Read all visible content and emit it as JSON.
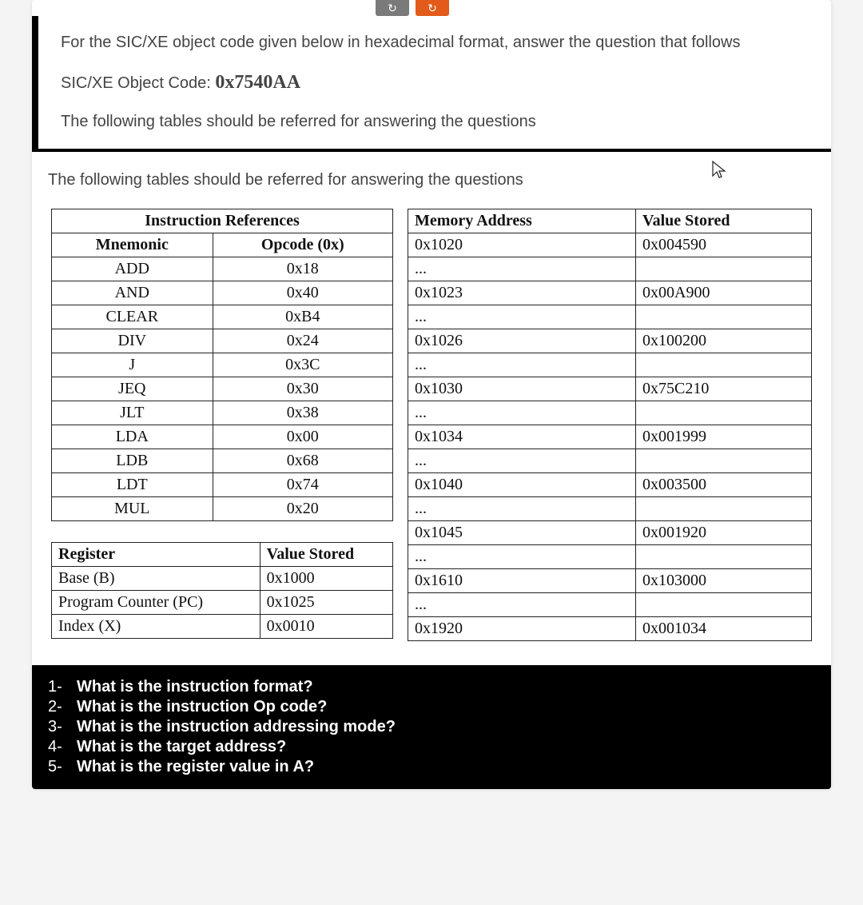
{
  "tabs": {
    "a_icon": "↻",
    "b_icon": "↻"
  },
  "intro": "For the SIC/XE object code given below in hexadecimal format, answer the question that follows",
  "object_code_label": "SIC/XE Object Code: ",
  "object_code_value": "0x7540AA",
  "ref_note": "The following tables should be referred for answering the questions",
  "ref_note_2": "The following tables should be referred for answering the questions",
  "instr_table": {
    "title": "Instruction References",
    "col1": "Mnemonic",
    "col2": "Opcode (0x)",
    "rows": [
      {
        "mn": "ADD",
        "op": "0x18"
      },
      {
        "mn": "AND",
        "op": "0x40"
      },
      {
        "mn": "CLEAR",
        "op": "0xB4"
      },
      {
        "mn": "DIV",
        "op": "0x24"
      },
      {
        "mn": "J",
        "op": "0x3C"
      },
      {
        "mn": "JEQ",
        "op": "0x30"
      },
      {
        "mn": "JLT",
        "op": "0x38"
      },
      {
        "mn": "LDA",
        "op": "0x00"
      },
      {
        "mn": "LDB",
        "op": "0x68"
      },
      {
        "mn": "LDT",
        "op": "0x74"
      },
      {
        "mn": "MUL",
        "op": "0x20"
      }
    ]
  },
  "reg_table": {
    "col1": "Register",
    "col2": "Value Stored",
    "rows": [
      {
        "r": "Base (B)",
        "v": "0x1000"
      },
      {
        "r": "Program Counter (PC)",
        "v": "0x1025"
      },
      {
        "r": "Index (X)",
        "v": "0x0010"
      }
    ]
  },
  "mem_table": {
    "col1": "Memory Address",
    "col2": "Value Stored",
    "rows": [
      {
        "a": "0x1020",
        "v": "0x004590"
      },
      {
        "a": "...",
        "v": ""
      },
      {
        "a": "0x1023",
        "v": "0x00A900"
      },
      {
        "a": "...",
        "v": ""
      },
      {
        "a": "0x1026",
        "v": "0x100200"
      },
      {
        "a": "...",
        "v": ""
      },
      {
        "a": "0x1030",
        "v": "0x75C210"
      },
      {
        "a": "...",
        "v": ""
      },
      {
        "a": "0x1034",
        "v": "0x001999"
      },
      {
        "a": "...",
        "v": ""
      },
      {
        "a": "0x1040",
        "v": "0x003500"
      },
      {
        "a": "...",
        "v": ""
      },
      {
        "a": "0x1045",
        "v": "0x001920"
      },
      {
        "a": "...",
        "v": ""
      },
      {
        "a": "0x1610",
        "v": "0x103000"
      },
      {
        "a": "...",
        "v": ""
      },
      {
        "a": "0x1920",
        "v": "0x001034"
      }
    ]
  },
  "questions": [
    {
      "n": "1-",
      "t": "What is the instruction format?"
    },
    {
      "n": "2-",
      "t": "What is the instruction Op code?"
    },
    {
      "n": "3-",
      "t": "What is the instruction addressing mode?"
    },
    {
      "n": "4-",
      "t": "What is the target address?"
    },
    {
      "n": "5-",
      "t": "What is the register value in A?"
    }
  ]
}
